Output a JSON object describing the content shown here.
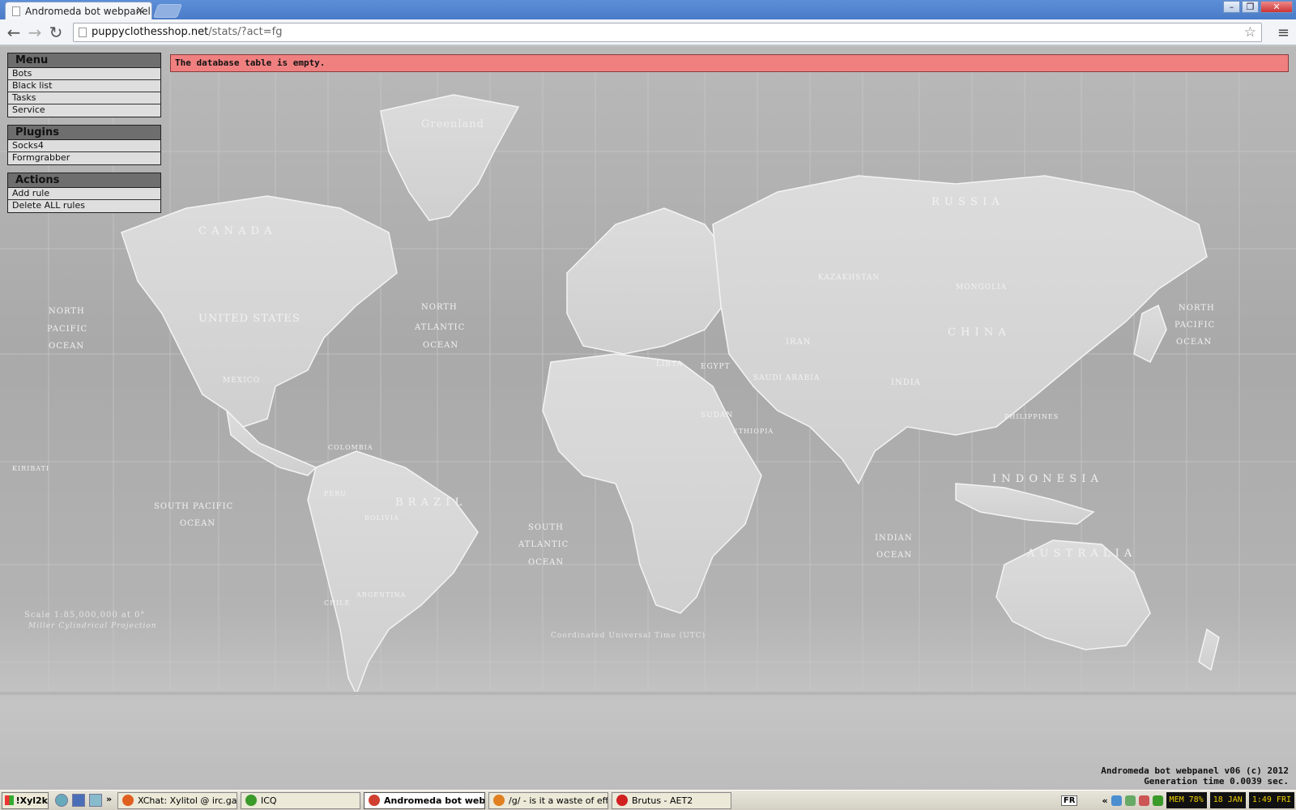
{
  "browser": {
    "tab_title": "Andromeda bot webpanel",
    "tab_close": "×",
    "url_host": "puppyclothesshop.net",
    "url_path": "/stats/?act=fg",
    "back": "←",
    "forward": "→",
    "reload": "↻",
    "star": "☆",
    "menu": "≡"
  },
  "sidebar": {
    "menu": {
      "title": "Menu",
      "items": [
        "Bots",
        "Black list",
        "Tasks",
        "Service"
      ]
    },
    "plugins": {
      "title": "Plugins",
      "items": [
        "Socks4",
        "Formgrabber"
      ]
    },
    "actions": {
      "title": "Actions",
      "items": [
        "Add rule",
        "Delete ALL rules"
      ]
    }
  },
  "alert": {
    "text": "The database table is empty.",
    "color": "#f08080"
  },
  "map_labels": {
    "greenland": "Greenland",
    "canada": "C A N A D A",
    "russia": "R U S S I A",
    "united_states": "UNITED STATES",
    "north_pacific": [
      "NORTH",
      "PACIFIC",
      "OCEAN"
    ],
    "north_atlantic": [
      "NORTH",
      "ATLANTIC",
      "OCEAN"
    ],
    "north_pacific_east": [
      "NORTH",
      "PACIFIC",
      "OCEAN"
    ],
    "china": "C H I N A",
    "mongolia": "MONGOLIA",
    "kazakhstan": "KAZAKHSTAN",
    "iran": "IRAN",
    "saudi_arabia": "SAUDI ARABIA",
    "sudan": "SUDAN",
    "libya": "LIBYA",
    "egypt": "EGYPT",
    "ethiopia": "ETHIOPIA",
    "india": "INDIA",
    "mexico": "MEXICO",
    "brazil": "B R A Z I L",
    "peru": "PERU",
    "bolivia": "BOLIVIA",
    "colombia": "COLOMBIA",
    "argentina": "ARGENTINA",
    "chile": "CHILE",
    "south_pacific": [
      "SOUTH PACIFIC",
      "OCEAN"
    ],
    "south_atlantic": [
      "SOUTH",
      "ATLANTIC",
      "OCEAN"
    ],
    "indian_ocean": [
      "INDIAN",
      "OCEAN"
    ],
    "indonesia": "I N D O N E S I A",
    "philippines": "PHILIPPINES",
    "australia": "A U S T R A L I A",
    "kiribati": "KIRIBATI",
    "scale": "Scale 1:85,000,000 at 0°",
    "projection": "Miller Cylindrical Projection",
    "utc": "Coordinated Universal Time (UTC)"
  },
  "footer": {
    "line1": "Andromeda bot webpanel v06 (c) 2012",
    "line2": "Generation time 0.0039 sec."
  },
  "taskbar": {
    "start_label": "!Xyl2k",
    "more": "»",
    "tasks": [
      {
        "label": "XChat: Xylitol @ irc.gate...",
        "icon_color": "#e06020"
      },
      {
        "label": "ICQ",
        "icon_color": "#3a9a2a"
      },
      {
        "label": "Andromeda bot webp...",
        "icon_color": "#d04030",
        "active": true
      },
      {
        "label": "/g/ - is it a waste of effo...",
        "icon_color": "#e08020"
      },
      {
        "label": "Brutus - AET2",
        "icon_color": "#d02020"
      }
    ],
    "lang": "FR",
    "tray_prefix": "«",
    "clock_date": "18 JAN",
    "clock_time": "1:49 FRI",
    "mem": "MEM 78%"
  }
}
